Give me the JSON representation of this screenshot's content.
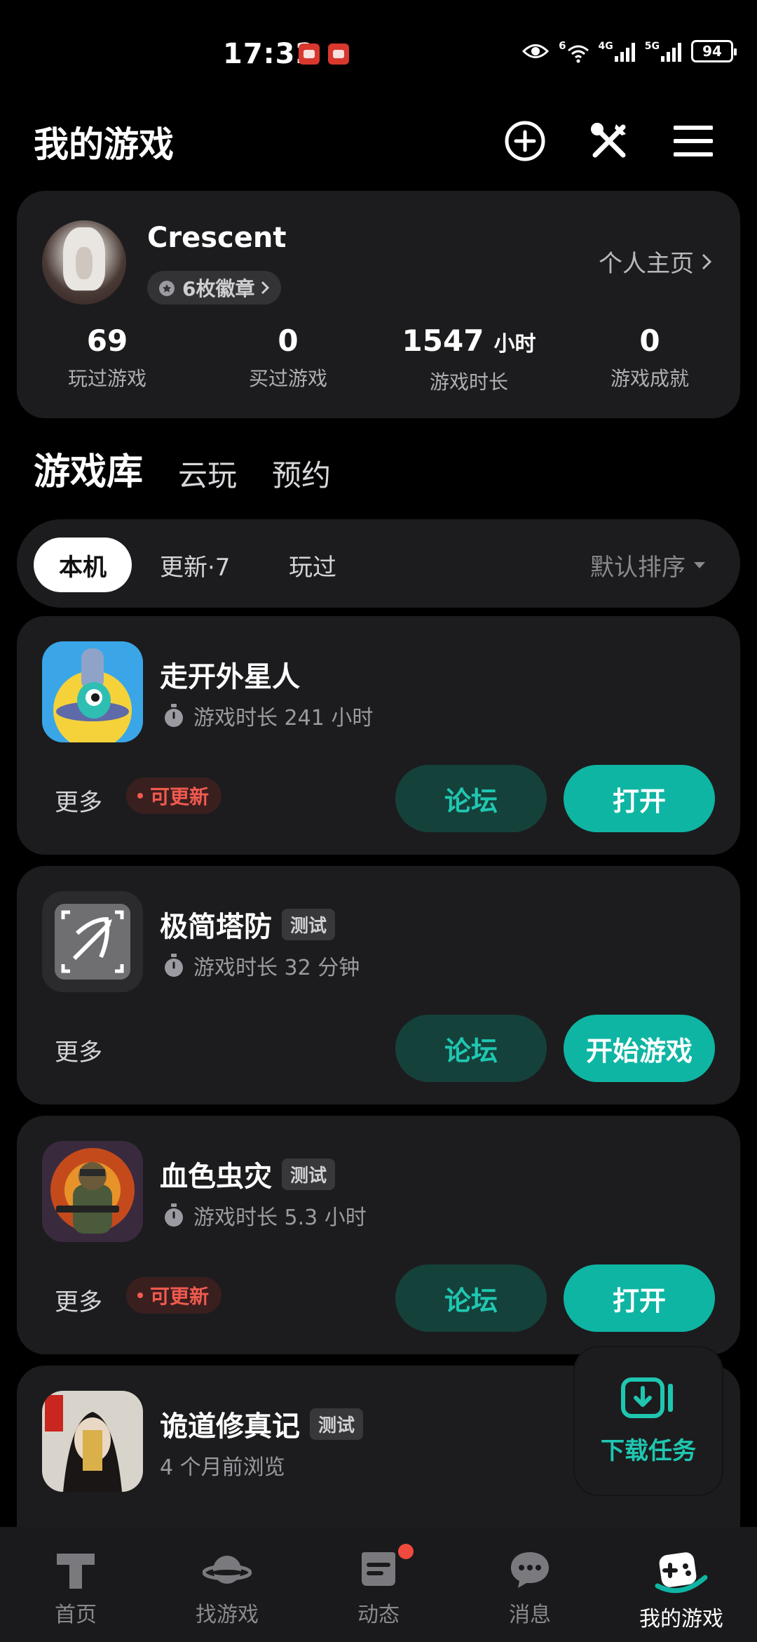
{
  "status_bar": {
    "time": "17:32",
    "battery": "94",
    "net1": "6",
    "net2": "4G",
    "net3": "5G"
  },
  "header": {
    "title": "我的游戏"
  },
  "profile": {
    "name": "Crescent",
    "badges": "6枚徽章",
    "homepage": "个人主页",
    "stats": [
      {
        "value": "69",
        "unit": "",
        "label": "玩过游戏"
      },
      {
        "value": "0",
        "unit": "",
        "label": "买过游戏"
      },
      {
        "value": "1547",
        "unit": "小时",
        "label": "游戏时长"
      },
      {
        "value": "0",
        "unit": "",
        "label": "游戏成就"
      }
    ]
  },
  "tabs": [
    "游戏库",
    "云玩",
    "预约"
  ],
  "filters": {
    "chips": [
      "本机",
      "更新·7",
      "玩过"
    ],
    "sort": "默认排序"
  },
  "games": [
    {
      "name": "走开外星人",
      "tag": "",
      "meta": "游戏时长 241 小时",
      "more": "更多",
      "update": "可更新",
      "forum": "论坛",
      "action": "打开"
    },
    {
      "name": "极简塔防",
      "tag": "测试",
      "meta": "游戏时长 32 分钟",
      "more": "更多",
      "update": "",
      "forum": "论坛",
      "action": "开始游戏"
    },
    {
      "name": "血色虫灾",
      "tag": "测试",
      "meta": "游戏时长 5.3 小时",
      "more": "更多",
      "update": "可更新",
      "forum": "论坛",
      "action": "打开"
    },
    {
      "name": "诡道修真记",
      "tag": "测试",
      "meta": "4 个月前浏览"
    }
  ],
  "download_task": {
    "label": "下载任务"
  },
  "nav": [
    {
      "label": "首页",
      "icon": "home-icon"
    },
    {
      "label": "找游戏",
      "icon": "planet-icon"
    },
    {
      "label": "动态",
      "icon": "feed-icon"
    },
    {
      "label": "消息",
      "icon": "chat-icon"
    },
    {
      "label": "我的游戏",
      "icon": "gamepad-icon"
    }
  ],
  "colors": {
    "accent": "#0fb5a3",
    "forum_bg": "#15413b",
    "update_red": "#f25a4f",
    "card_bg": "#1c1c1e"
  }
}
